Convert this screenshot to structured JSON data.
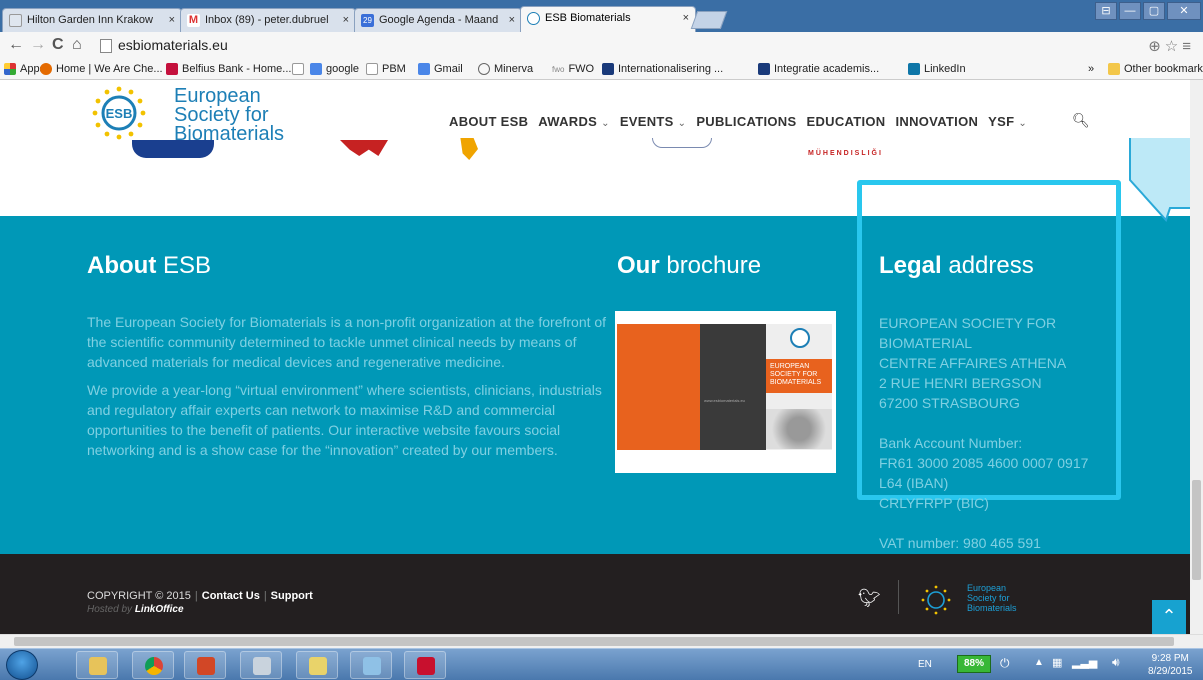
{
  "browser": {
    "tabs": [
      {
        "label": "Hilton Garden Inn Krakow",
        "close": "×"
      },
      {
        "label": "Inbox (89) - peter.dubruel",
        "close": "×"
      },
      {
        "label": "Google Agenda - Maand",
        "close": "×"
      },
      {
        "label": "ESB Biomaterials",
        "close": "×"
      }
    ],
    "url": "esbiomaterials.eu",
    "bookmarks": [
      "Apps",
      "Home | We Are Che...",
      "Belfius Bank - Home...",
      "",
      "google",
      "PBM",
      "Gmail",
      "Minerva",
      "FWO",
      "Internationalisering ...",
      "Integratie academis...",
      "LinkedIn",
      "»",
      "Other bookmarks"
    ],
    "fwo_prefix": "fwo",
    "gmail_badge": "M",
    "calendar_badge": "29",
    "win_min": "—",
    "win_max": "▢",
    "win_close": "✕",
    "win_user": "⊟"
  },
  "site": {
    "logo": {
      "line1": "European",
      "line2": "Society for",
      "line3": "Biomaterials",
      "mono": "ESB"
    },
    "nav": [
      {
        "label": "ABOUT ESB",
        "dropdown": false
      },
      {
        "label": "AWARDS",
        "dropdown": true
      },
      {
        "label": "EVENTS",
        "dropdown": true
      },
      {
        "label": "PUBLICATIONS",
        "dropdown": false
      },
      {
        "label": "EDUCATION",
        "dropdown": false
      },
      {
        "label": "INNOVATION",
        "dropdown": false
      },
      {
        "label": "YSF",
        "dropdown": true
      }
    ],
    "partner_caption": "MÜHENDISLIĞI"
  },
  "footer": {
    "about": {
      "heading_bold": "About",
      "heading_light": "ESB",
      "paragraphs": [
        "The European Society for Biomaterials is a non-profit organization at the forefront of the scientific community determined to tackle unmet clinical needs by means of advanced materials for medical devices and regenerative medicine.",
        "We provide a year-long “virtual environment” where scientists, clinicians, industrials and regulatory affair experts can network to maximise R&D and commercial opportunities to the benefit of patients. Our interactive website favours social networking and is a show case for the “innovation” created by our members."
      ]
    },
    "brochure": {
      "heading_bold": "Our",
      "heading_light": "brochure",
      "cover_title": "EUROPEAN SOCIETY FOR BIOMATERIALS",
      "cover_url": "www.esbiomaterials.eu"
    },
    "legal": {
      "heading_bold": "Legal",
      "heading_light": "address",
      "lines": [
        "EUROPEAN SOCIETY FOR",
        "BIOMATERIAL",
        "CENTRE AFFAIRES ATHENA",
        "2 RUE HENRI BERGSON",
        "67200 STRASBOURG",
        "",
        "Bank Account Number:",
        "FR61 3000 2085 4600 0007 0917",
        "L64 (IBAN)",
        "CRLYFRPP (BIC)",
        "",
        "VAT number: 980 465 591"
      ]
    },
    "bottom": {
      "copyright": "COPYRIGHT © 2015",
      "contact": "Contact Us",
      "support": "Support",
      "hosted_prefix": "Hosted by",
      "hosted_by": "LinkOffice",
      "logo_line1": "European",
      "logo_line2": "Society for",
      "logo_line3": "Biomaterials"
    }
  },
  "taskbar": {
    "lang": "EN",
    "battery": "88%",
    "time": "9:28 PM",
    "date": "8/29/2015"
  },
  "colors": {
    "footer_teal": "#0098b7",
    "highlight_box": "#29c7ee",
    "footer_bottom": "#231f20",
    "esb_blue": "#1d7fb6"
  }
}
